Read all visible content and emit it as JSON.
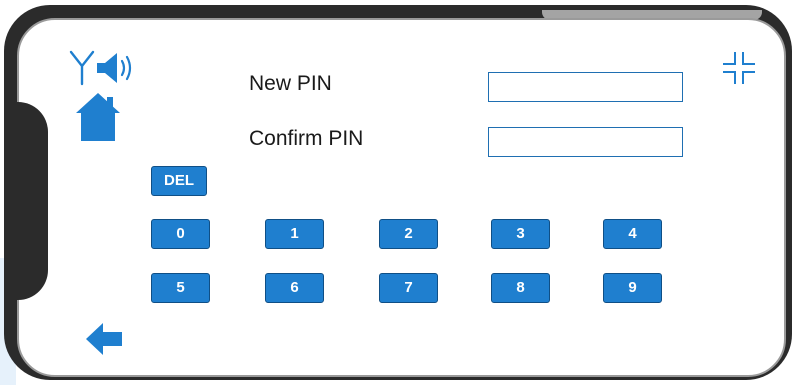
{
  "form": {
    "new_pin_label": "New PIN",
    "new_pin_value": "",
    "confirm_pin_label": "Confirm PIN",
    "confirm_pin_value": ""
  },
  "keypad": {
    "del_label": "DEL",
    "keys": [
      "0",
      "1",
      "2",
      "3",
      "4",
      "5",
      "6",
      "7",
      "8",
      "9"
    ]
  },
  "icons": {
    "antenna": "antenna-icon",
    "speaker": "speaker-icon",
    "home": "home-icon",
    "fullscreen_exit": "fullscreen-exit-icon",
    "back": "back-arrow-icon"
  },
  "colors": {
    "accent": "#1f7fcf",
    "accent_border": "#0f4f86",
    "field_border": "#1f6fb2",
    "phone_frame": "#2b2b2b"
  }
}
